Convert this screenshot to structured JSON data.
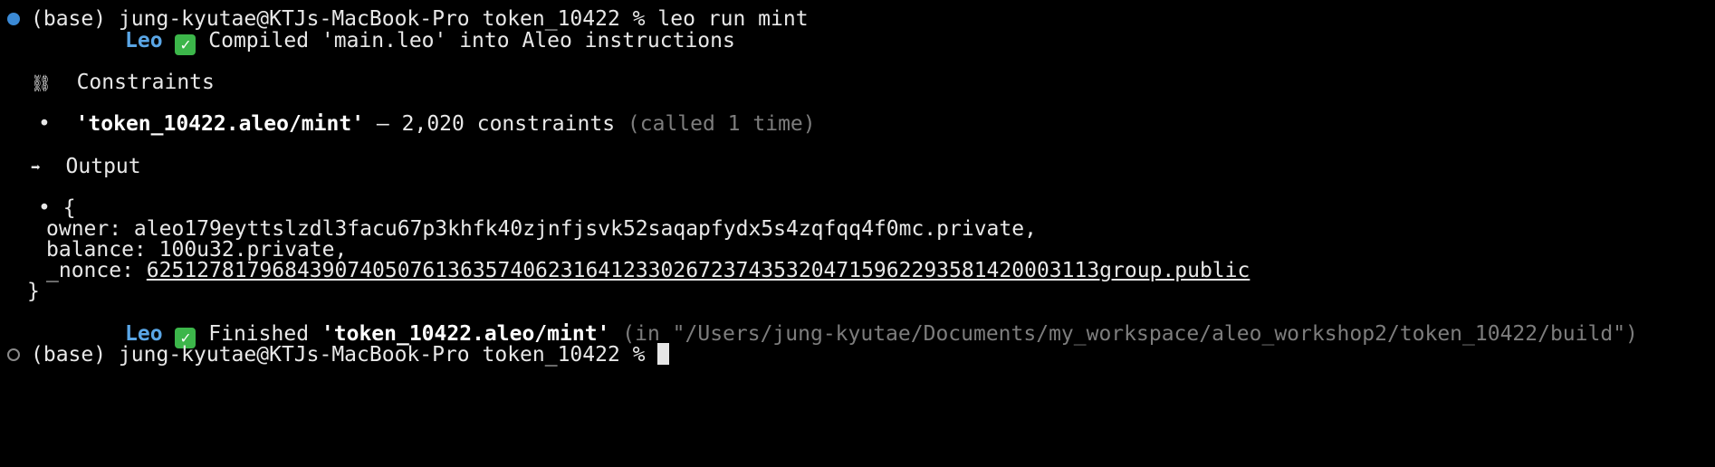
{
  "terminal": {
    "prompt": "(base) jung-kyutae@KTJs-MacBook-Pro token_10422 %",
    "command": "leo run mint",
    "compile_tag": "Leo",
    "check_icon": "green-check-icon",
    "compile_msg": "Compiled 'main.leo' into Aleo instructions",
    "constraints_icon": "⛓",
    "constraints_heading": "Constraints",
    "bullet": "•",
    "constraint_name": "'token_10422.aleo/mint'",
    "constraint_dash": "–",
    "constraint_count": "2,020 constraints",
    "constraint_called": "(called 1 time)",
    "output_icon": "➡",
    "output_heading": "Output",
    "output_open": "{",
    "owner_line": "owner: aleo179eyttslzdl3facu67p3khfk40zjnfjsvk52saqapfydx5s4zqfqq4f0mc.private,",
    "balance_line": "balance: 100u32.private,",
    "nonce_label": "_nonce:",
    "nonce_value": "6251278179684390740507613635740623164123302672374353204715962293581420003113group.public",
    "output_close": "}",
    "finish_tag": "Leo",
    "finish_word": "Finished",
    "finish_program": "'token_10422.aleo/mint'",
    "finish_path": "(in \"/Users/jung-kyutae/Documents/my_workspace/aleo_workshop2/token_10422/build\")",
    "prompt2": "(base) jung-kyutae@KTJs-MacBook-Pro token_10422 %"
  },
  "colors": {
    "background": "#000000",
    "text": "#e8e8e8",
    "leo_blue": "#5aa6e6",
    "check_green": "#3cb64a",
    "dim_gray": "#7d7d7d",
    "marker_blue": "#3b8ad6"
  }
}
